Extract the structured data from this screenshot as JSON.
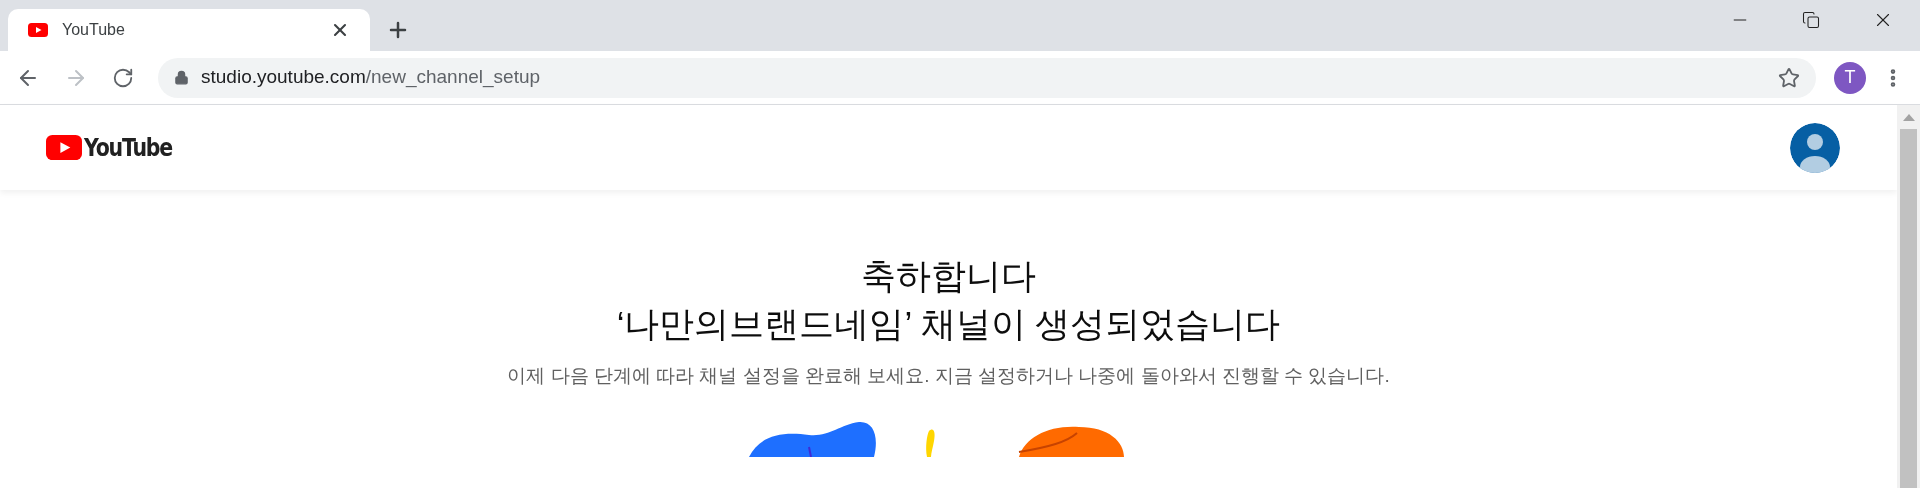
{
  "browser": {
    "tab": {
      "title": "YouTube",
      "selected": true
    },
    "address": {
      "host": "studio.youtube.com",
      "path": "/new_channel_setup"
    },
    "profile": "T"
  },
  "page": {
    "logo": "YouTube",
    "title_lines": [
      "축하합니다",
      "‘나만의브랜드네임’ 채널이 생성되었습니다"
    ],
    "subtitle": "이제 다음 단계에 따라 채널 설정을 완료해 보세요. 지금 설정하거나 나중에 돌아와서 진행할 수 있습니다."
  }
}
